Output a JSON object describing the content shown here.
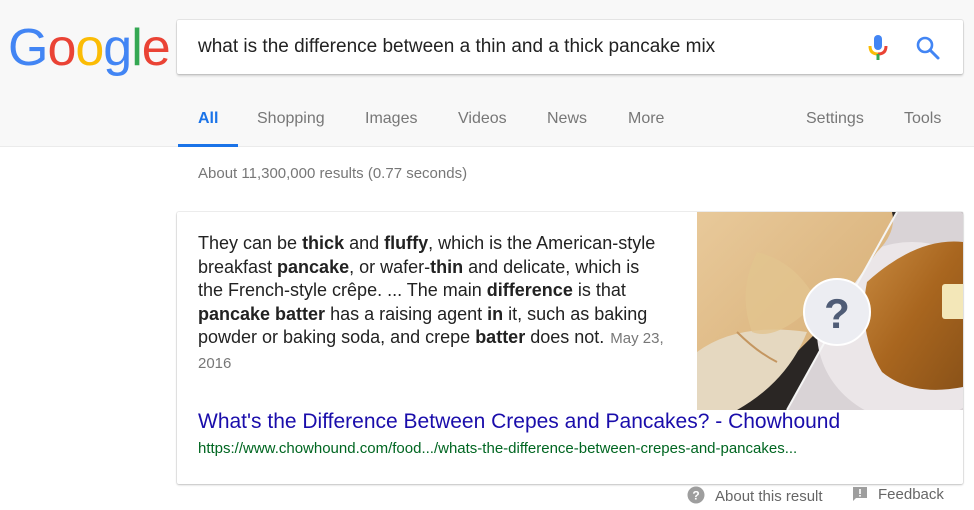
{
  "logo": {
    "letters": [
      {
        "char": "G",
        "color": "#4285f4"
      },
      {
        "char": "o",
        "color": "#ea4335"
      },
      {
        "char": "o",
        "color": "#fbbc05"
      },
      {
        "char": "g",
        "color": "#4285f4"
      },
      {
        "char": "l",
        "color": "#34a853"
      },
      {
        "char": "e",
        "color": "#ea4335"
      }
    ]
  },
  "search": {
    "query": "what is the difference between a thin and a thick pancake mix",
    "mic_icon": "microphone-icon",
    "search_icon": "magnifier-icon"
  },
  "tabs": [
    {
      "label": "All",
      "active": true
    },
    {
      "label": "Shopping"
    },
    {
      "label": "Images"
    },
    {
      "label": "Videos"
    },
    {
      "label": "News"
    },
    {
      "label": "More"
    }
  ],
  "tools": {
    "settings": "Settings",
    "tools": "Tools"
  },
  "stats": "About 11,300,000 results (0.77 seconds)",
  "featured": {
    "snippet": [
      {
        "t": "They can be ",
        "b": false
      },
      {
        "t": "thick",
        "b": true
      },
      {
        "t": " and ",
        "b": false
      },
      {
        "t": "fluffy",
        "b": true
      },
      {
        "t": ", which is the American-style breakfast ",
        "b": false
      },
      {
        "t": "pancake",
        "b": true
      },
      {
        "t": ", or wafer-",
        "b": false
      },
      {
        "t": "thin",
        "b": true
      },
      {
        "t": " and delicate, which is the French-style crêpe. ... The main ",
        "b": false
      },
      {
        "t": "difference",
        "b": true
      },
      {
        "t": " is that ",
        "b": false
      },
      {
        "t": "pancake batter",
        "b": true
      },
      {
        "t": " has a raising agent ",
        "b": false
      },
      {
        "t": "in",
        "b": true
      },
      {
        "t": " it, such as baking powder or baking soda, and crepe ",
        "b": false
      },
      {
        "t": "batter",
        "b": true
      },
      {
        "t": " does not.",
        "b": false
      }
    ],
    "date": "May 23, 2016",
    "image_alt": "crepes vs pancakes with question mark",
    "title": "What's the Difference Between Crepes and Pancakes? - Chowhound",
    "url": "https://www.chowhound.com/food.../whats-the-difference-between-crepes-and-pancakes..."
  },
  "footer": {
    "about": "About this result",
    "feedback": "Feedback"
  },
  "colors": {
    "accent": "#1a73e8",
    "link": "#1a0dab",
    "url": "#006621",
    "muted": "#777777"
  }
}
